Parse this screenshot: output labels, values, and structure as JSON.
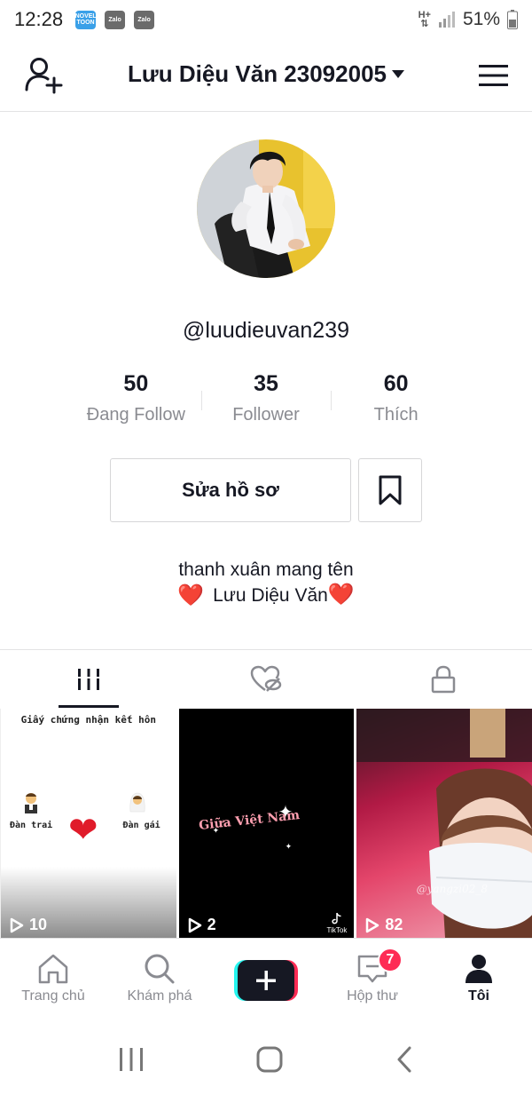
{
  "status_bar": {
    "time": "12:28",
    "notifications": [
      "NOVEL TOON",
      "Zalo",
      "Zalo"
    ],
    "network": "H+",
    "battery": "51%"
  },
  "header": {
    "title": "Lưu Diệu Văn 23092005",
    "left_icon": "add-user-icon",
    "right_icon": "hamburger-menu-icon"
  },
  "profile": {
    "username": "@luudieuvan239",
    "stats": [
      {
        "value": "50",
        "label": "Đang Follow"
      },
      {
        "value": "35",
        "label": "Follower"
      },
      {
        "value": "60",
        "label": "Thích"
      }
    ],
    "edit_button": "Sửa hồ sơ",
    "bio_line1": "thanh xuân mang tên",
    "bio_line2": "Lưu Diệu Văn",
    "bio_heart": "❤️"
  },
  "tabs": [
    {
      "icon": "grid-icon",
      "active": true
    },
    {
      "icon": "liked-hidden-icon",
      "active": false
    },
    {
      "icon": "lock-icon",
      "active": false
    }
  ],
  "videos": [
    {
      "views": "10",
      "cert_title": "Giấy chứng nhận kết hôn",
      "cert_left": "Đàn trai",
      "cert_right": "Đàn gái"
    },
    {
      "views": "2",
      "overlay_text": "Giữa Việt Nam",
      "watermark": "TikTok"
    },
    {
      "views": "82",
      "watermark": "@yangzi02_8"
    }
  ],
  "bottom_nav": [
    {
      "label": "Trang chủ",
      "icon": "home-icon"
    },
    {
      "label": "Khám phá",
      "icon": "search-icon"
    },
    {
      "label": "",
      "icon": "plus-icon"
    },
    {
      "label": "Hộp thư",
      "icon": "inbox-icon",
      "badge": "7"
    },
    {
      "label": "Tôi",
      "icon": "profile-icon",
      "active": true
    }
  ],
  "colors": {
    "primary_text": "#161823",
    "secondary_text": "#8a8b91",
    "accent": "#fe2c55",
    "cyan": "#25f4ee",
    "divider": "#e3e3e4"
  }
}
